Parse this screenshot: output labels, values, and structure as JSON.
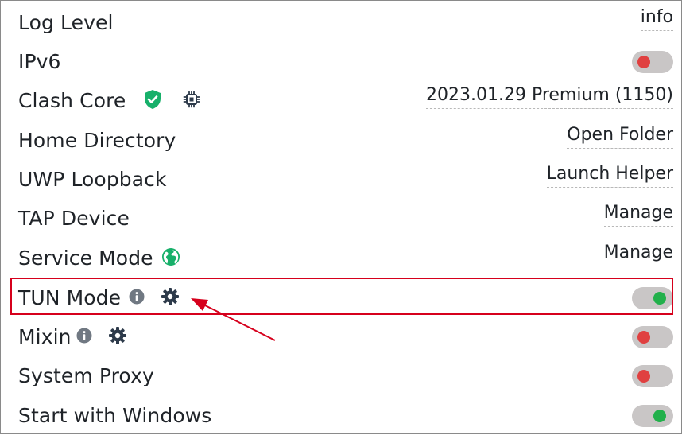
{
  "settings": {
    "rows": [
      {
        "label": "Log Level",
        "value": "info"
      },
      {
        "label": "IPv6",
        "toggle": "off"
      },
      {
        "label": "Clash Core",
        "value": "2023.01.29 Premium (1150)",
        "icons": [
          "verified-shield-icon",
          "cpu-chip-icon"
        ]
      },
      {
        "label": "Home Directory",
        "value": "Open Folder"
      },
      {
        "label": "UWP Loopback",
        "value": "Launch Helper"
      },
      {
        "label": "TAP Device",
        "value": "Manage"
      },
      {
        "label": "Service Mode",
        "value": "Manage",
        "icons": [
          "globe-icon"
        ]
      },
      {
        "label": "TUN Mode",
        "toggle": "on",
        "icons": [
          "info-icon",
          "gear-icon"
        ]
      },
      {
        "label": "Mixin",
        "toggle": "off",
        "icons": [
          "info-icon",
          "gear-icon"
        ]
      },
      {
        "label": "System Proxy",
        "toggle": "off"
      },
      {
        "label": "Start with Windows",
        "toggle": "on"
      }
    ]
  },
  "colors": {
    "toggle_on": "#22b04b",
    "toggle_off": "#e04040",
    "toggle_track": "#c9c6c6",
    "highlight": "#d6001c",
    "shield_green": "#17b06a",
    "icon_dark": "#2d3a4a",
    "info_gray": "#707882"
  }
}
